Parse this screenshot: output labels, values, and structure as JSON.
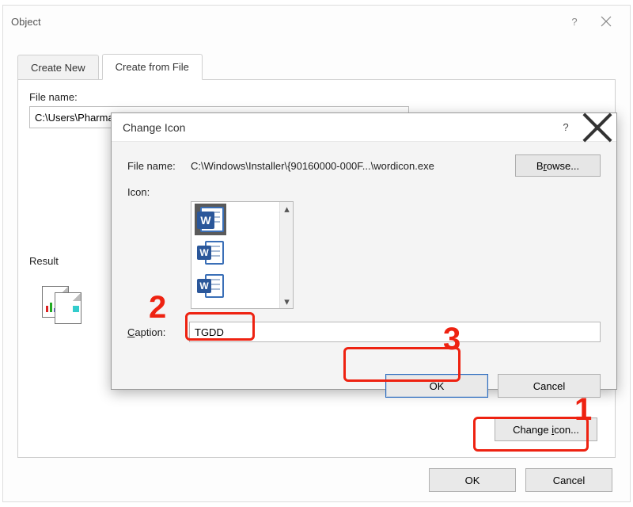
{
  "object_dialog": {
    "title": "Object",
    "tabs": {
      "create_new": "Create New",
      "create_from_file": "Create from File"
    },
    "file_name_label": "File name:",
    "file_name_value": "C:\\Users\\Pharma",
    "result_label": "Result",
    "change_icon_btn": "Change",
    "ok": "OK",
    "cancel": "Cancel"
  },
  "change_icon_dialog": {
    "title": "Change Icon",
    "help": "?",
    "file_name_label": "File name:",
    "file_name_value": "C:\\Windows\\Installer\\{90160000-000F...\\wordicon.exe",
    "browse_pre": "B",
    "browse_u": "r",
    "browse_post": "owse...",
    "icon_label": "Icon:",
    "caption_label_u": "C",
    "caption_label_post": "aption:",
    "caption_value": "TGDD",
    "ok": "OK",
    "cancel": "Cancel"
  },
  "annotations": {
    "n1": "1",
    "n2": "2",
    "n3": "3"
  },
  "glyphs": {
    "help": "?",
    "up": "▴",
    "down": "▾",
    "w": "W",
    "icon_u": "i",
    "icon_post": "con..."
  }
}
